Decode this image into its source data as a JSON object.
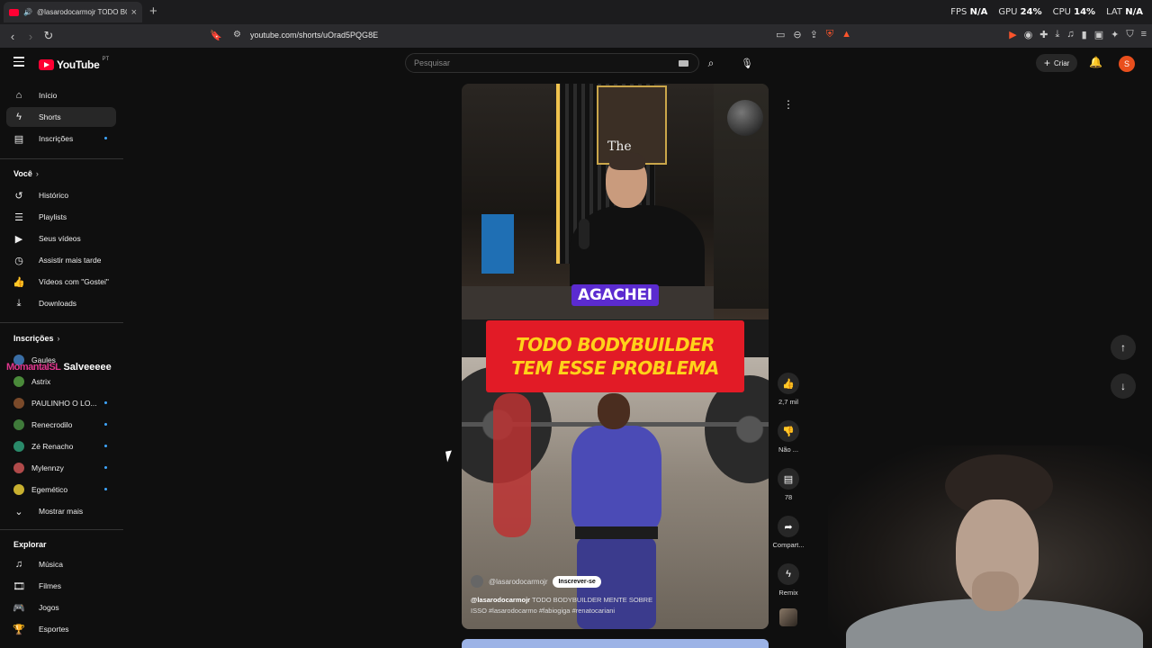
{
  "browser": {
    "tab_title": "@lasarodocarmojr TODO BO",
    "url": "youtube.com/shorts/uOrad5PQG8E",
    "hud": {
      "fps_label": "FPS",
      "fps_value": "N/A",
      "gpu_label": "GPU",
      "gpu_value": "24%",
      "cpu_label": "CPU",
      "cpu_value": "14%",
      "lat_label": "LAT",
      "lat_value": "N/A"
    }
  },
  "header": {
    "logo": "YouTube",
    "country": "PT",
    "search_placeholder": "Pesquisar",
    "create_label": "Criar",
    "avatar_letter": "S"
  },
  "sidebar": {
    "main": [
      {
        "label": "Início",
        "icon": "home-icon"
      },
      {
        "label": "Shorts",
        "icon": "shorts-icon"
      },
      {
        "label": "Inscrições",
        "icon": "subscriptions-icon"
      }
    ],
    "you_title": "Você",
    "you": [
      {
        "label": "Histórico"
      },
      {
        "label": "Playlists"
      },
      {
        "label": "Seus vídeos"
      },
      {
        "label": "Assistir mais tarde"
      },
      {
        "label": "Vídeos com \"Gostei\""
      },
      {
        "label": "Downloads"
      }
    ],
    "subs_title": "Inscrições",
    "subs": [
      {
        "label": "Gaules",
        "color": "#3a6ea5"
      },
      {
        "label": "Astrix",
        "color": "#4a8a3a"
      },
      {
        "label": "PAULINHO O LO...",
        "color": "#7a4a2a"
      },
      {
        "label": "Renecrodilo",
        "color": "#3f7a3a"
      },
      {
        "label": "Zé Renacho",
        "color": "#2a8a6a"
      },
      {
        "label": "Mylennzy",
        "color": "#b04a4a"
      },
      {
        "label": "Egemético",
        "color": "#c8b030"
      }
    ],
    "show_more": "Mostrar mais",
    "explore_title": "Explorar",
    "explore": [
      {
        "label": "Música"
      },
      {
        "label": "Filmes"
      },
      {
        "label": "Jogos"
      },
      {
        "label": "Esportes"
      }
    ],
    "overlay_name": "MomantaISL",
    "overlay_msg": "Salveeeee"
  },
  "video": {
    "poster_text": "The",
    "tag": "AGACHEI",
    "title_line1": "TODO BODYBUILDER",
    "title_line2": "TEM ESSE PROBLEMA",
    "channel": "@lasarodocarmojr",
    "subscribe": "Inscrever-se",
    "desc_handle": "@lasarodocarmojr",
    "desc_text": " TODO BODYBUILDER MENTE SOBRE",
    "desc_line2": "ISSO #lasarodocarmo #fabiogiga #renatocariani"
  },
  "actions": {
    "likes": "2,7 mil",
    "dislike": "Não ...",
    "comments": "78",
    "share": "Compart...",
    "remix": "Remix"
  }
}
